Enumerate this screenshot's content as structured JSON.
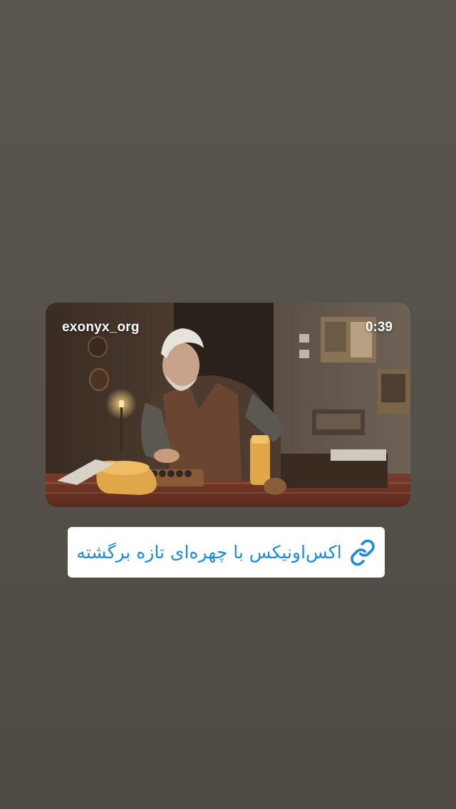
{
  "story": {
    "video": {
      "username": "exonyx_org",
      "duration": "0:39"
    },
    "link_sticker": {
      "label": "اکس‌اونیکس با چهره‌ای تازه برگشته",
      "icon": "link-icon",
      "color": "#1a8cd8"
    }
  }
}
